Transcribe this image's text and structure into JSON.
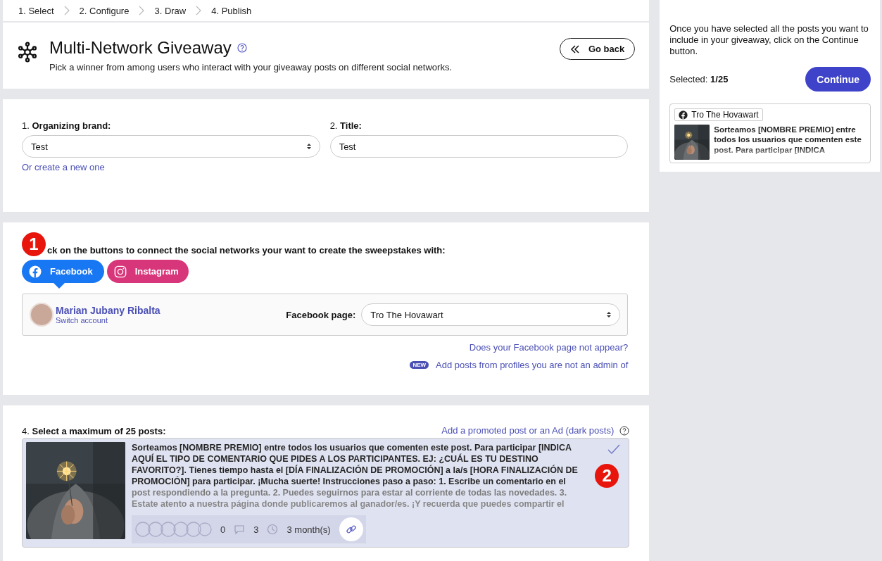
{
  "steps": [
    {
      "label": "1. Select"
    },
    {
      "label": "2. Configure"
    },
    {
      "label": "3. Draw"
    },
    {
      "label": "4. Publish"
    }
  ],
  "header": {
    "title": "Multi-Network Giveaway",
    "description": "Pick a winner from among users who interact with your giveaway posts on different social networks.",
    "back_button": "Go back"
  },
  "form": {
    "fields": [
      {
        "label": "1. **Organizing brand:**",
        "value": "Test",
        "kind": "select"
      },
      {
        "label": "2. **Title:**",
        "value": "Test",
        "kind": "text"
      }
    ],
    "create_link": "Or create a new one"
  },
  "networks": {
    "label": "ck on the buttons to connect the social networks your want to create the sweepstakes with:",
    "buttons": [
      {
        "kind": "facebook",
        "label": "Facebook",
        "selected": true
      },
      {
        "kind": "instagram",
        "label": "Instagram",
        "selected": false
      }
    ],
    "account": {
      "name": "Marian Jubany Ribalta",
      "switch_link": "Switch account",
      "page_label": "Facebook page:",
      "page_value": "Tro The Hovawart"
    },
    "help_link": "Does your Facebook page not appear?",
    "new_badge": "NEW",
    "admin_link": "Add posts from profiles you are not an admin of"
  },
  "posts": {
    "label": "4. **Select a maximum of 25 posts:**",
    "promoted_link": "Add a promoted post or an Ad (dark posts)",
    "items": [
      {
        "selected": true,
        "text": "Sorteamos [NOMBRE PREMIO] entre todos los usuarios que comenten este post. Para participar [INDICA AQUÍ EL TIPO DE COMENTARIO QUE PIDES A LOS PARTICIPANTES. EJ: ¿CUÁL ES TU DESTINO FAVORITO?]. Tienes tiempo hasta el [DÍA FINALIZACIÓN DE PROMOCIÓN] a la/s [HORA FINALIZACIÓN DE PROMOCIÓN] para participar. ¡Mucha suerte! Instrucciones paso a paso: 1. Escribe un comentario en el post respondiendo a la pregunta. 2. Puedes seguirnos para estar al corriente de todas las novedades. 3. Estate atento a nuestra página donde publicaremos al ganador/es. ¡Y recuerda que puedes compartir el",
        "reactions": "0",
        "comments": "3",
        "age": "3 month(s)"
      }
    ]
  },
  "sidebar": {
    "instructions": "Once you have selected all the posts you want to include in your giveaway, click on the Continue button.",
    "selected": "Selected: **1/25**",
    "continue_button": "Continue",
    "cards": [
      {
        "page": "Tro The Hovawart",
        "text": "Sorteamos [NOMBRE PREMIO] entre todos los usuarios que comenten este post. Para participar [INDICA"
      }
    ]
  },
  "annotations": [
    {
      "label": "1"
    },
    {
      "label": "2"
    }
  ]
}
